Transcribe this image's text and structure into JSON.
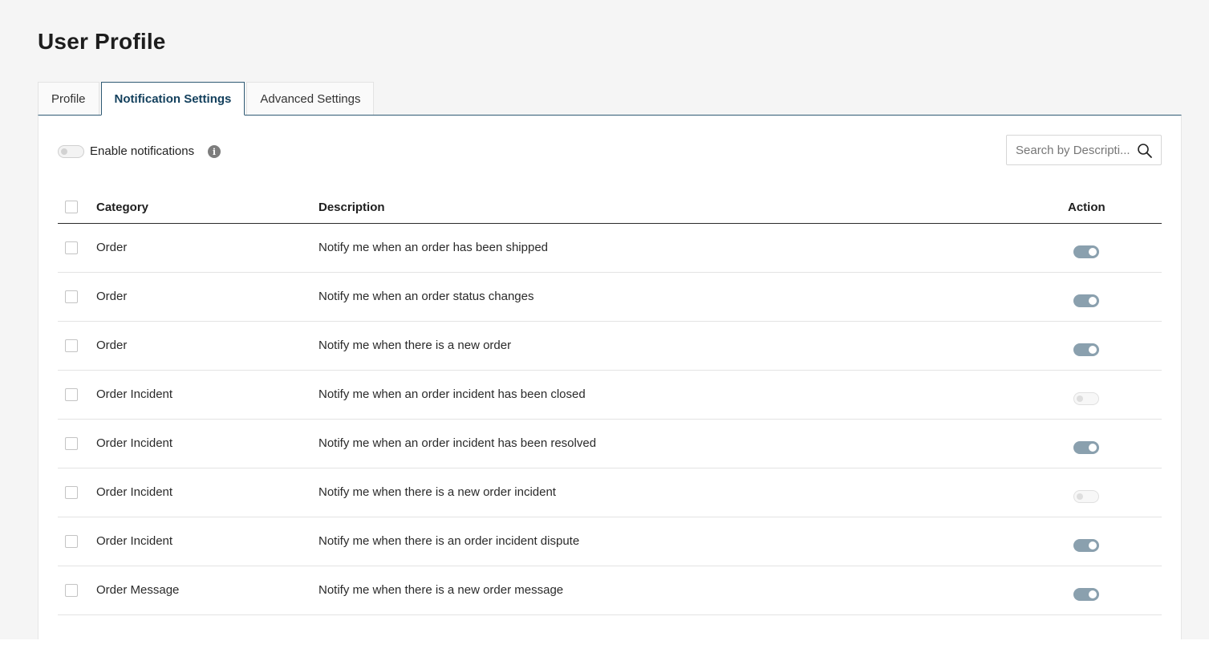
{
  "page": {
    "title": "User Profile"
  },
  "tabs": [
    {
      "label": "Profile",
      "active": false
    },
    {
      "label": "Notification Settings",
      "active": true
    },
    {
      "label": "Advanced Settings",
      "active": false
    }
  ],
  "toolbar": {
    "enable_label": "Enable notifications",
    "enable_checked": false,
    "info_glyph": "i",
    "search_placeholder": "Search by Descripti..."
  },
  "table": {
    "headers": {
      "category": "Category",
      "description": "Description",
      "action": "Action"
    },
    "rows": [
      {
        "category": "Order",
        "description": "Notify me when an order has been shipped",
        "enabled": true
      },
      {
        "category": "Order",
        "description": "Notify me when an order status changes",
        "enabled": true
      },
      {
        "category": "Order",
        "description": "Notify me when there is a new order",
        "enabled": true
      },
      {
        "category": "Order Incident",
        "description": "Notify me when an order incident has been closed",
        "enabled": false
      },
      {
        "category": "Order Incident",
        "description": "Notify me when an order incident has been resolved",
        "enabled": true
      },
      {
        "category": "Order Incident",
        "description": "Notify me when there is a new order incident",
        "enabled": false
      },
      {
        "category": "Order Incident",
        "description": "Notify me when there is an order incident dispute",
        "enabled": true
      },
      {
        "category": "Order Message",
        "description": "Notify me when there is a new order message",
        "enabled": true
      }
    ]
  },
  "colors": {
    "accent": "#123f5c",
    "toggle_on": "#8aa0ae",
    "page_bg": "#f5f5f5"
  }
}
